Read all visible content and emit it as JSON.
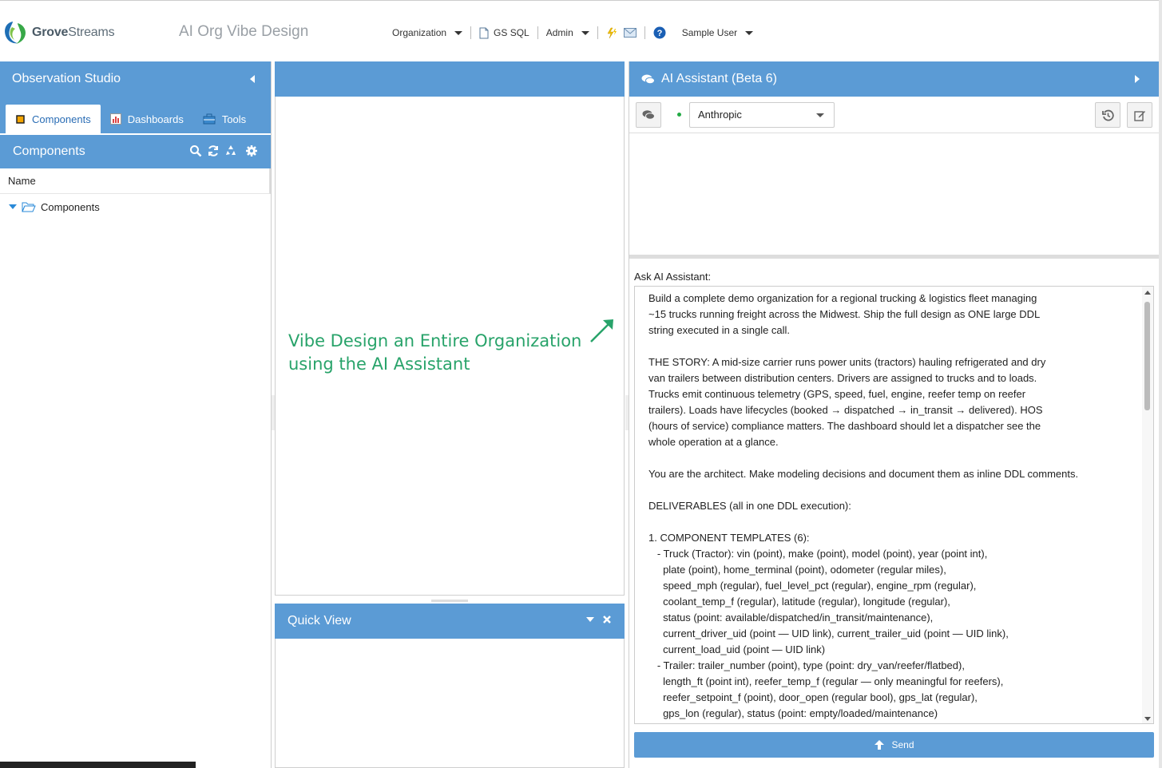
{
  "header": {
    "logo_text_bold": "Grove",
    "logo_text_light": "Streams",
    "org_title": "AI Org Vibe Design",
    "nav": {
      "organization": "Organization",
      "gs_sql": "GS SQL",
      "admin": "Admin",
      "user": "Sample User"
    }
  },
  "left_panel": {
    "title": "Observation Studio",
    "tabs": [
      {
        "label": "Components",
        "active": true
      },
      {
        "label": "Dashboards",
        "active": false
      },
      {
        "label": "Tools",
        "active": false
      }
    ],
    "components_title": "Components",
    "tree_header": "Name",
    "tree_root": "Components"
  },
  "center_panel": {
    "annotation_line1": "Vibe Design an Entire Organization",
    "annotation_line2": "using the AI Assistant",
    "annotation_color": "#28a36a",
    "quick_view_title": "Quick View"
  },
  "right_panel": {
    "title": "AI Assistant (Beta 6)",
    "provider": "Anthropic",
    "ask_label": "Ask AI Assistant:",
    "prompt_text": "Build a complete demo organization for a regional trucking & logistics fleet managing\n~15 trucks running freight across the Midwest. Ship the full design as ONE large DDL\nstring executed in a single call.\n\nTHE STORY: A mid-size carrier runs power units (tractors) hauling refrigerated and dry\nvan trailers between distribution centers. Drivers are assigned to trucks and to loads.\nTrucks emit continuous telemetry (GPS, speed, fuel, engine, reefer temp on reefer\ntrailers). Loads have lifecycles (booked → dispatched → in_transit → delivered). HOS\n(hours of service) compliance matters. The dashboard should let a dispatcher see the\nwhole operation at a glance.\n\nYou are the architect. Make modeling decisions and document them as inline DDL comments.\n\nDELIVERABLES (all in one DDL execution):\n\n1. COMPONENT TEMPLATES (6):\n   - Truck (Tractor): vin (point), make (point), model (point), year (point int),\n     plate (point), home_terminal (point), odometer (regular miles),\n     speed_mph (regular), fuel_level_pct (regular), engine_rpm (regular),\n     coolant_temp_f (regular), latitude (regular), longitude (regular),\n     status (point: available/dispatched/in_transit/maintenance),\n     current_driver_uid (point — UID link), current_trailer_uid (point — UID link),\n     current_load_uid (point — UID link)\n   - Trailer: trailer_number (point), type (point: dry_van/reefer/flatbed),\n     length_ft (point int), reefer_temp_f (regular — only meaningful for reefers),\n     reefer_setpoint_f (point), door_open (regular bool), gps_lat (regular),\n     gps_lon (regular), status (point: empty/loaded/maintenance)",
    "send_label": "Send"
  },
  "colors": {
    "header_blue": "#5b9bd5",
    "active_tab_text": "#2a6db5"
  }
}
